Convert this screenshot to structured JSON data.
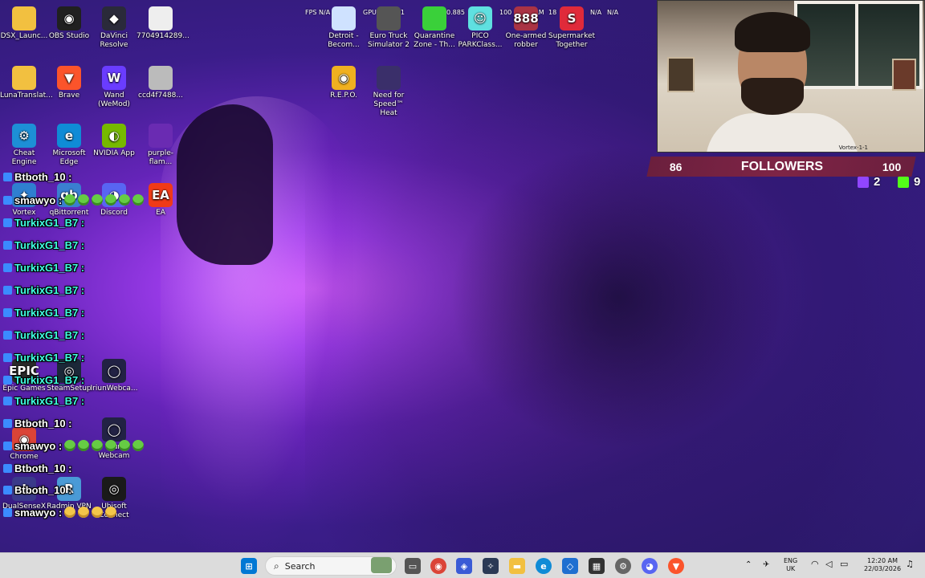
{
  "perf_overlay": {
    "fps": "FPS N/A N/A",
    "gpu": "GPU 60°C 21",
    "val1": "0.885",
    "val2": "100",
    "ram": "RAM",
    "cpu": "18",
    "na1": "N/A",
    "na2": "N/A"
  },
  "desktop_icons": [
    {
      "label": "DSX_Launc...",
      "icon": "folder-icon",
      "color": "#f2c040",
      "glyph": ""
    },
    {
      "label": "OBS Studio",
      "icon": "obs-icon",
      "color": "#202020",
      "glyph": "◉"
    },
    {
      "label": "DaVinci Resolve",
      "icon": "davinci-icon",
      "color": "#2a2a3a",
      "glyph": "◆"
    },
    {
      "label": "7704914289...",
      "icon": "image-file-icon",
      "color": "#eeeeee",
      "glyph": ""
    },
    {
      "label": "LunaTranslat...",
      "icon": "folder-icon",
      "color": "#f2c040",
      "glyph": ""
    },
    {
      "label": "Brave",
      "icon": "brave-icon",
      "color": "#fb542b",
      "glyph": "▼"
    },
    {
      "label": "Wand (WeMod)",
      "icon": "wand-icon",
      "color": "#6a3cff",
      "glyph": "W"
    },
    {
      "label": "ccd4f7488...",
      "icon": "image-file-icon",
      "color": "#bbbbbb",
      "glyph": ""
    },
    {
      "label": "Cheat Engine",
      "icon": "cheat-engine-icon",
      "color": "#1d8fd6",
      "glyph": "⚙"
    },
    {
      "label": "Microsoft Edge",
      "icon": "edge-icon",
      "color": "#0f8bd6",
      "glyph": "e"
    },
    {
      "label": "NVIDIA App",
      "icon": "nvidia-icon",
      "color": "#76b900",
      "glyph": "◐"
    },
    {
      "label": "purple-flam...",
      "icon": "image-file-icon",
      "color": "#6a2bb2",
      "glyph": ""
    },
    {
      "label": "Vortex",
      "icon": "vortex-icon",
      "color": "#2f7fd0",
      "glyph": "✦"
    },
    {
      "label": "qBittorrent",
      "icon": "qbittorrent-icon",
      "color": "#3a7fd0",
      "glyph": "qb"
    },
    {
      "label": "Discord",
      "icon": "discord-icon",
      "color": "#5865f2",
      "glyph": "◕"
    },
    {
      "label": "EA",
      "icon": "ea-icon",
      "color": "#f03a17",
      "glyph": "EA"
    },
    {
      "label": "Epic Games",
      "icon": "epic-games-icon",
      "color": "#2a2a2a",
      "glyph": "EPIC"
    },
    {
      "label": "SteamSetup",
      "icon": "steam-icon",
      "color": "#1b2838",
      "glyph": "◎"
    },
    {
      "label": "IriunWebca...",
      "icon": "iriun-icon",
      "color": "#222244",
      "glyph": "◯"
    },
    {
      "label": "Chrome",
      "icon": "chrome-icon",
      "color": "#db4437",
      "glyph": "◉"
    },
    {
      "label": "Iriun Webcam",
      "icon": "iriun-icon",
      "color": "#222244",
      "glyph": "◯"
    },
    {
      "label": "DualSenseX",
      "icon": "dualsense-icon",
      "color": "#3a3a8a",
      "glyph": "✚"
    },
    {
      "label": "Radmin VPN",
      "icon": "radmin-icon",
      "color": "#4a9ad6",
      "glyph": "R"
    },
    {
      "label": "Ubisoft Connect",
      "icon": "ubisoft-icon",
      "color": "#1a1a1a",
      "glyph": "◎"
    },
    {
      "label": "Detroit - Becom...",
      "icon": "detroit-icon",
      "color": "#cfe2ff",
      "glyph": ""
    },
    {
      "label": "Euro Truck Simulator 2",
      "icon": "ets2-icon",
      "color": "#555555",
      "glyph": ""
    },
    {
      "label": "Quarantine Zone - Th...",
      "icon": "quarantine-icon",
      "color": "#3ad03a",
      "glyph": ""
    },
    {
      "label": "PICO PARKClass...",
      "icon": "pico-park-icon",
      "color": "#5fe0e0",
      "glyph": "☺"
    },
    {
      "label": "One-armed robber",
      "icon": "one-armed-robber-icon",
      "color": "#aa3344",
      "glyph": "888"
    },
    {
      "label": "Supermarket Together",
      "icon": "supermarket-icon",
      "color": "#e02a3a",
      "glyph": "S"
    },
    {
      "label": "R.E.P.O.",
      "icon": "repo-icon",
      "color": "#f0b020",
      "glyph": "◉"
    },
    {
      "label": "Need for Speed™ Heat",
      "icon": "nfs-heat-icon",
      "color": "#3a2f6a",
      "glyph": ""
    }
  ],
  "chat": [
    {
      "user": "Btboth_10 :",
      "msg": "",
      "teal": false,
      "emotes": 0,
      "style": "g"
    },
    {
      "user": "smawyo :",
      "msg": "",
      "teal": false,
      "emotes": 6,
      "style": "g"
    },
    {
      "user": "TurkixG1_B7 :",
      "msg": "",
      "teal": true,
      "emotes": 0,
      "style": "g"
    },
    {
      "user": "TurkixG1_B7 :",
      "msg": "",
      "teal": true,
      "emotes": 0,
      "style": "g"
    },
    {
      "user": "TurkixG1_B7 :",
      "msg": "",
      "teal": true,
      "emotes": 0,
      "style": "g"
    },
    {
      "user": "TurkixG1_B7 :",
      "msg": "",
      "teal": true,
      "emotes": 0,
      "style": "g"
    },
    {
      "user": "TurkixG1_B7 :",
      "msg": "",
      "teal": true,
      "emotes": 0,
      "style": "g"
    },
    {
      "user": "TurkixG1_B7 :",
      "msg": "",
      "teal": true,
      "emotes": 0,
      "style": "g"
    },
    {
      "user": "TurkixG1_B7 :",
      "msg": "",
      "teal": true,
      "emotes": 0,
      "style": "g"
    },
    {
      "user": "TurkixG1_B7 :",
      "msg": "",
      "teal": true,
      "emotes": 0,
      "style": "g"
    },
    {
      "user": "TurkixG1_B7 :",
      "msg": "",
      "teal": true,
      "emotes": 0,
      "style": "g"
    },
    {
      "user": "Btboth_10 :",
      "msg": "",
      "teal": false,
      "emotes": 0,
      "style": "g"
    },
    {
      "user": "smawyo :",
      "msg": "",
      "teal": false,
      "emotes": 6,
      "style": "g"
    },
    {
      "user": "Btboth_10 :",
      "msg": "",
      "teal": false,
      "emotes": 0,
      "style": "g"
    },
    {
      "user": "Btboth_10 :",
      "msg": "",
      "teal": false,
      "emotes": 0,
      "style": "g"
    },
    {
      "user": "smawyo :",
      "msg": "",
      "teal": false,
      "emotes": 4,
      "style": "y"
    }
  ],
  "webcam": {
    "tag": "Vortex-1-1"
  },
  "followers": {
    "current": "86",
    "label": "FOLLOWERS",
    "goal": "100"
  },
  "platform_counts": {
    "twitch": "2",
    "kick": "9"
  },
  "taskbar": {
    "search_label": "Search",
    "lang": "ENG",
    "region": "UK",
    "time": "12:20 AM",
    "date": "22/03/2026"
  },
  "colors": {
    "wallpaper_accent": "#a23ef0",
    "followers_bar": "#7e2446",
    "chat_teal": "#41ffe3",
    "twitch": "#9146ff",
    "kick": "#53fc18"
  }
}
